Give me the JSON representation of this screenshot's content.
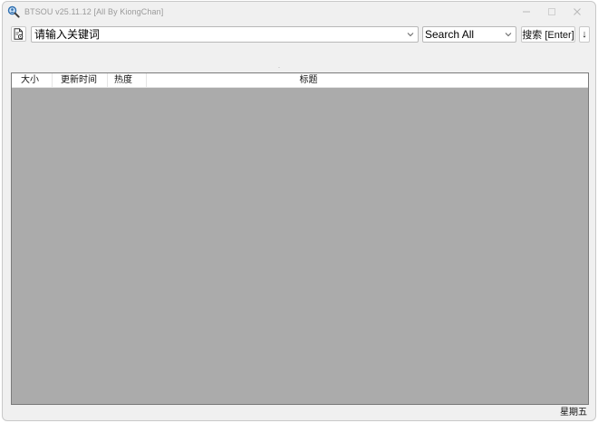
{
  "window": {
    "title": "BTSOU v25.11.12 [All By KiongChan]"
  },
  "icons": {
    "app": "magnifier-person-icon",
    "file_button": "document-gear-icon",
    "combo_dropdown": "chevron-down-icon",
    "scope_dropdown": "chevron-down-icon",
    "minimize": "minimize-icon",
    "maximize": "maximize-icon",
    "close": "close-icon"
  },
  "toolbar": {
    "search_placeholder": "请输入关键词",
    "scope_value": "Search All",
    "search_button_label": "搜索 [Enter]",
    "sort_button_label": "↓"
  },
  "results": {
    "columns": [
      "大小",
      "更新时间",
      "热度",
      "标题"
    ],
    "rows": []
  },
  "status": {
    "weekday": "星期五"
  },
  "colors": {
    "window_bg": "#f0f0f0",
    "list_bg": "#ababab",
    "title_text": "#9a9a9a"
  }
}
